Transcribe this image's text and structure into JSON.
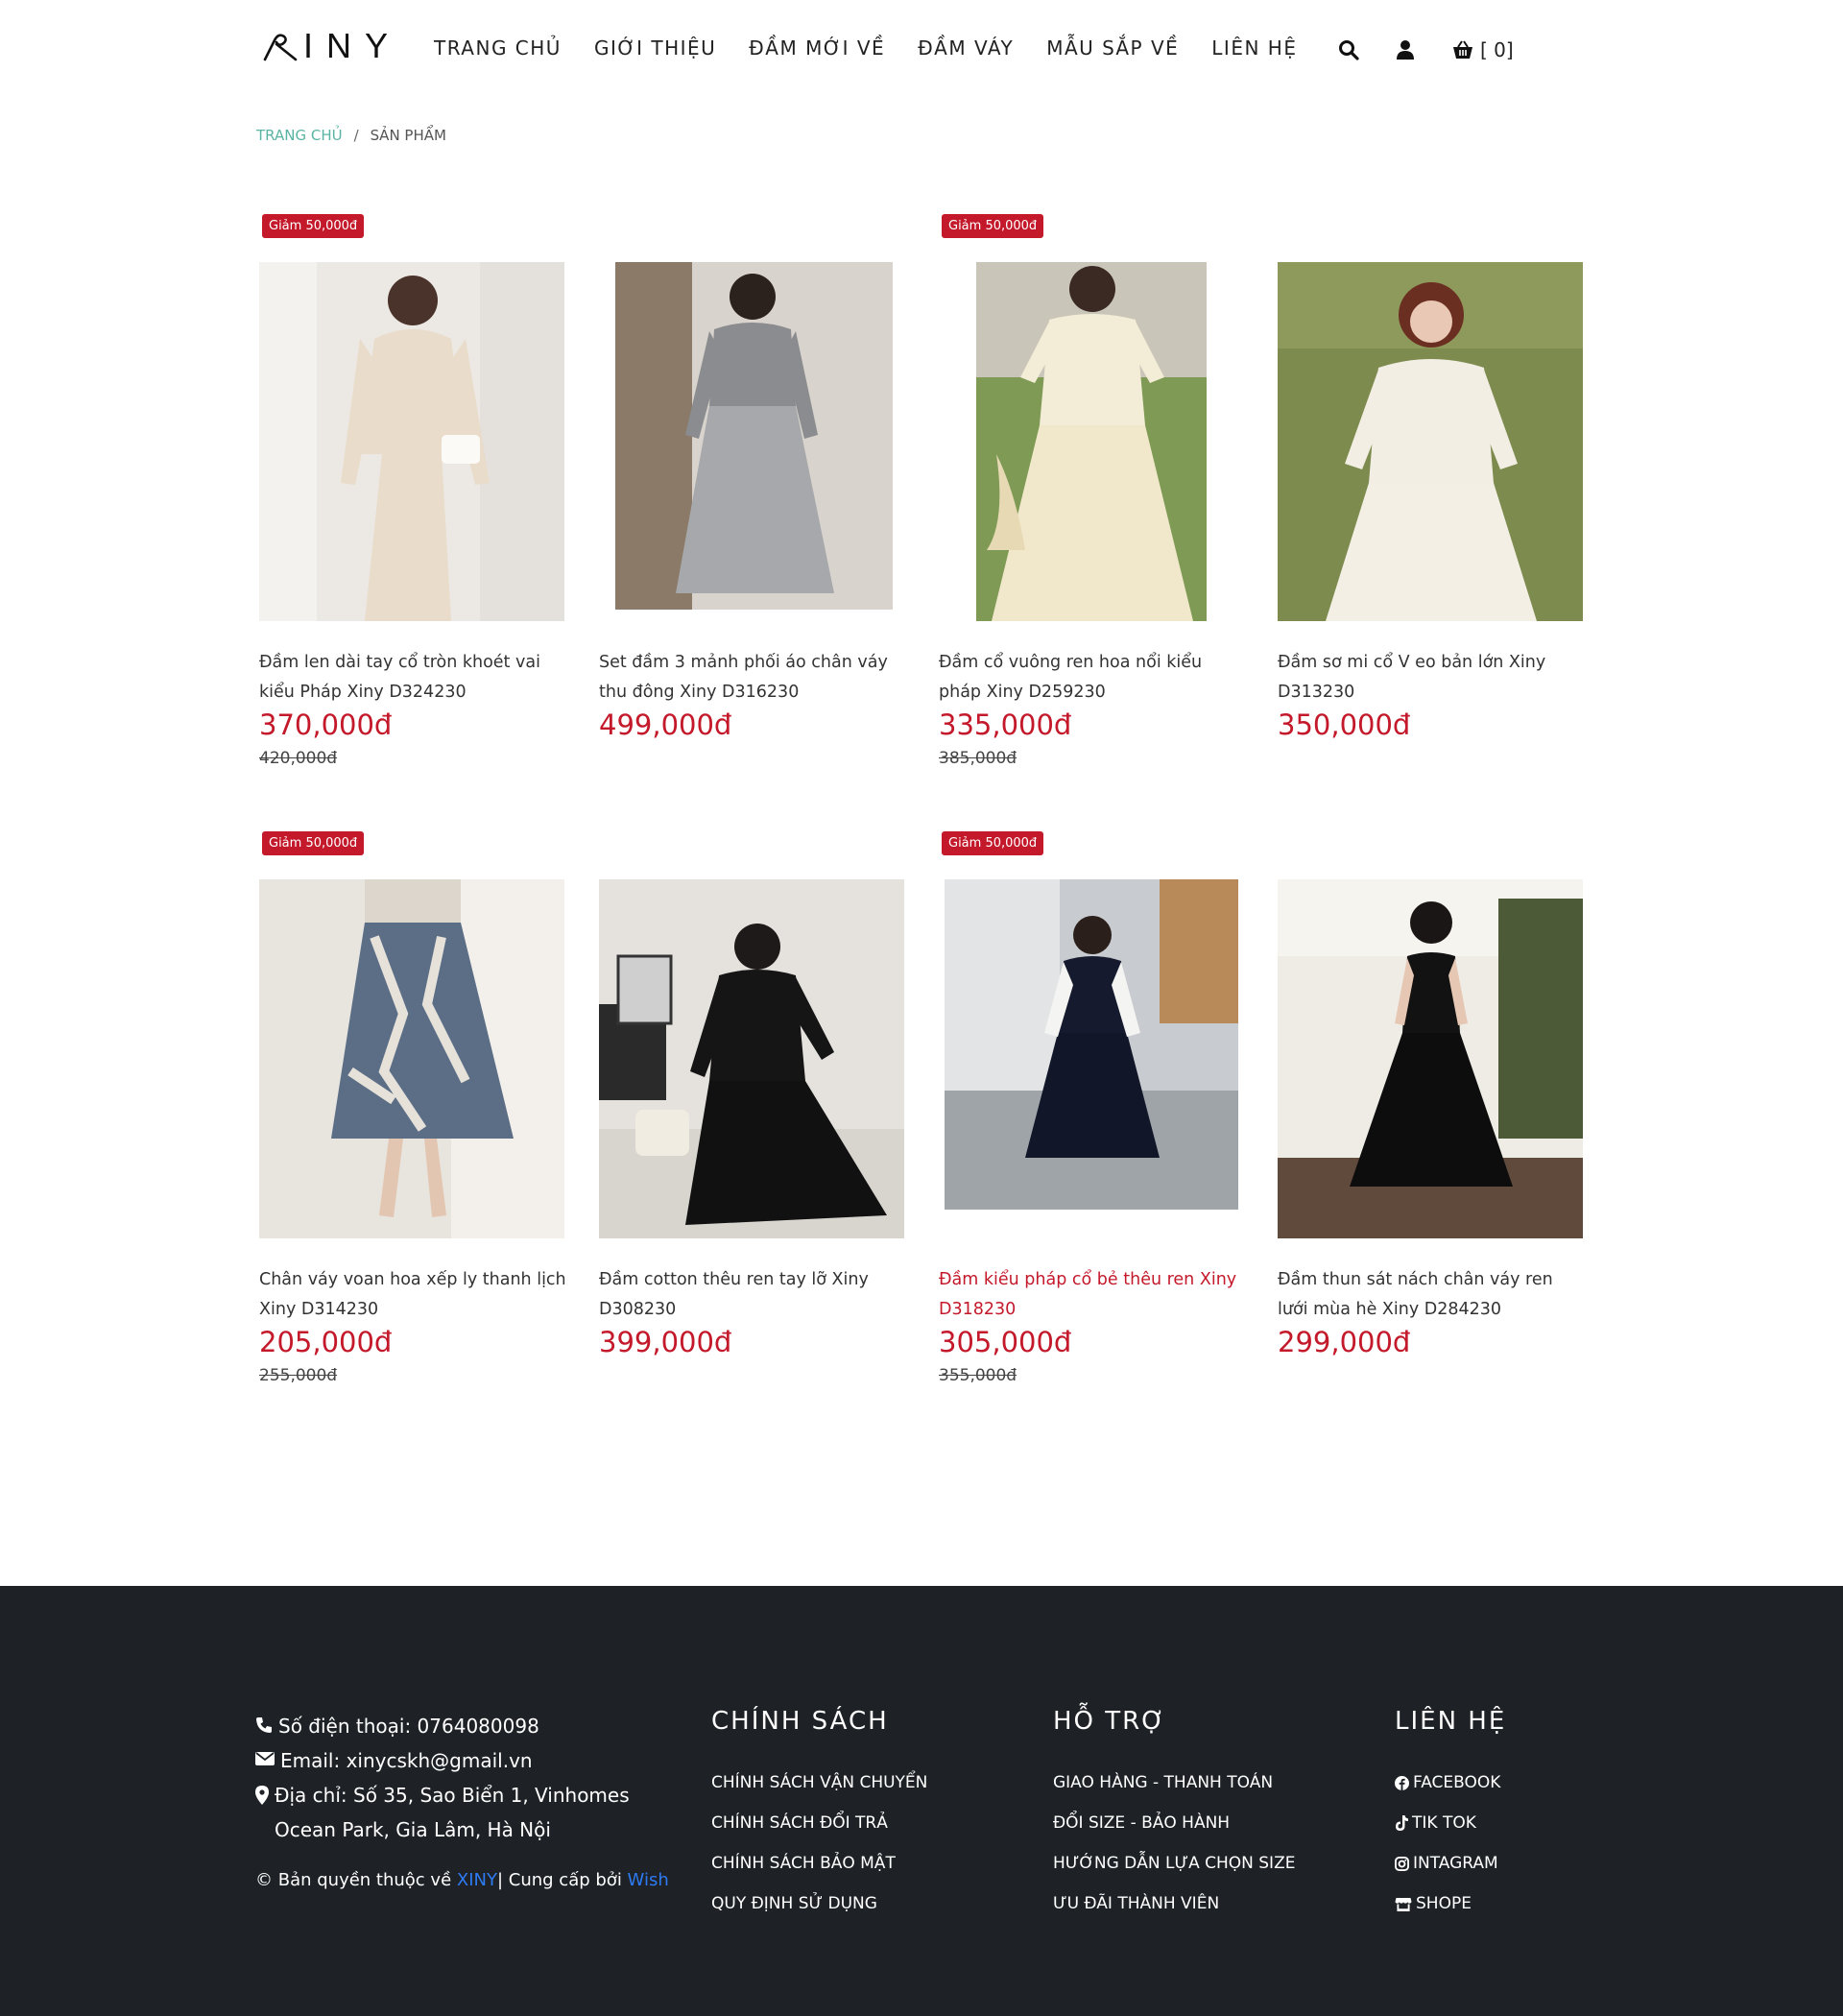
{
  "header": {
    "logo_text": "INY",
    "nav": [
      "TRANG CHỦ",
      "GIỚI THIỆU",
      "ĐẦM MỚI VỀ",
      "ĐẦM VÁY",
      "MẪU SẮP VỀ",
      "LIÊN HỆ"
    ],
    "cart_label": "[ 0]"
  },
  "breadcrumb": {
    "home": "TRANG CHỦ",
    "sep": "/",
    "current": "SẢN PHẨM"
  },
  "products": [
    {
      "badge": "Giảm 50,000đ",
      "name": "Đầm len dài tay cổ tròn khoét vai kiểu Pháp Xiny D324230",
      "price": "370,000đ",
      "old_price": "420,000đ"
    },
    {
      "badge": "",
      "name": "Set đầm 3 mảnh phối áo chân váy thu đông Xiny D316230",
      "price": "499,000đ",
      "old_price": ""
    },
    {
      "badge": "Giảm 50,000đ",
      "name": "Đầm cổ vuông ren hoa nổi kiểu pháp Xiny D259230",
      "price": "335,000đ",
      "old_price": "385,000đ"
    },
    {
      "badge": "",
      "name": "Đầm sơ mi cổ V eo bản lớn Xiny D313230",
      "price": "350,000đ",
      "old_price": ""
    },
    {
      "badge": "Giảm 50,000đ",
      "name": "Chân váy voan hoa xếp ly thanh lịch Xiny D314230",
      "price": "205,000đ",
      "old_price": "255,000đ"
    },
    {
      "badge": "",
      "name": "Đầm cotton thêu ren tay lỡ Xiny D308230",
      "price": "399,000đ",
      "old_price": ""
    },
    {
      "badge": "Giảm 50,000đ",
      "name": "Đầm kiểu pháp cổ bẻ thêu ren Xiny D318230",
      "price": "305,000đ",
      "old_price": "355,000đ"
    },
    {
      "badge": "",
      "name": "Đầm thun sát nách chân váy ren lưới mùa hè Xiny D284230",
      "price": "299,000đ",
      "old_price": ""
    }
  ],
  "footer": {
    "phone": "Số điện thoại: 0764080098",
    "email": "Email: xinycskh@gmail.vn",
    "address": "Địa chỉ: Số 35, Sao Biển 1, Vinhomes Ocean Park, Gia Lâm, Hà Nội",
    "copyright_prefix": "© Bản quyền thuộc về ",
    "copyright_brand": "XINY",
    "copyright_mid": "| Cung cấp bởi ",
    "copyright_provider": "Wish",
    "policy_title": "CHÍNH SÁCH",
    "policy_items": [
      "CHÍNH SÁCH VẬN CHUYỂN",
      "CHÍNH SÁCH ĐỔI TRẢ",
      "CHÍNH SÁCH BẢO MẬT",
      "QUY ĐỊNH SỬ DỤNG"
    ],
    "support_title": "HỖ TRỢ",
    "support_items": [
      "GIAO HÀNG - THANH TOÁN",
      "ĐỔI SIZE - BẢO HÀNH",
      "HƯỚNG DẪN LỰA CHỌN SIZE",
      "ƯU ĐÃI THÀNH VIÊN"
    ],
    "contact_title": "LIÊN HỆ",
    "contact_items": [
      "FACEBOOK",
      "TIK TOK",
      "INTAGRAM",
      "SHOPE"
    ]
  },
  "colors": {
    "accent": "#c4192b",
    "breadcrumb_home": "#5ab4a3",
    "footer_bg": "#1e2226",
    "link_blue": "#2d7bf4"
  },
  "icons": [
    "search-icon",
    "user-icon",
    "cart-icon",
    "phone-icon",
    "email-icon",
    "location-icon",
    "facebook-icon",
    "tiktok-icon",
    "instagram-icon",
    "shop-icon"
  ]
}
